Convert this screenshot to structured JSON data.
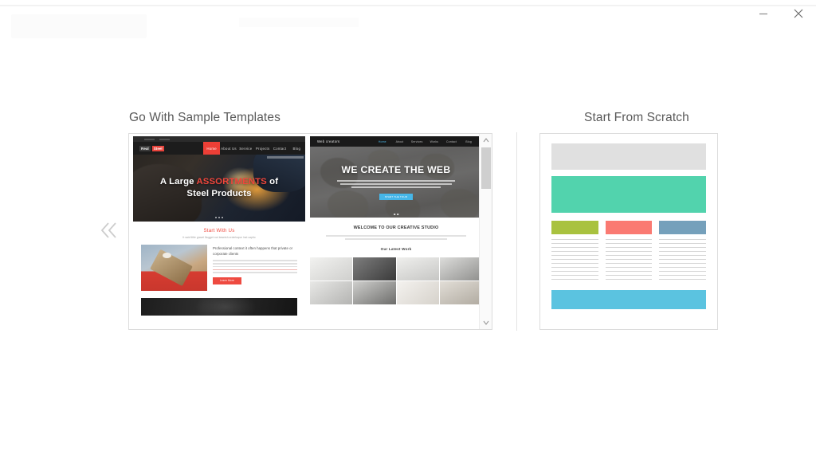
{
  "window": {
    "minimize_label": "Minimize",
    "close_label": "Close",
    "minimize_icon": "minimize-icon",
    "close_icon": "close-icon"
  },
  "nav": {
    "prev_icon": "chevron-double-left-icon",
    "prev_label": "Previous templates"
  },
  "sections": {
    "samples_heading": "Go With Sample Templates",
    "scratch_heading": "Start From Scratch"
  },
  "scrollbar": {
    "up_icon": "chevron-up-icon",
    "down_icon": "chevron-down-icon",
    "thumb_name": "scrollbar-thumb"
  },
  "templates": [
    {
      "id": "real-steel",
      "logo_first": "Real",
      "logo_second": "Steel",
      "menu": [
        "Home",
        "About Us",
        "Service",
        "Projects",
        "Contact",
        "Blog"
      ],
      "active_menu": "Home",
      "hero_line1_a": "A Large ",
      "hero_line1_b": "ASSORTMENTS",
      "hero_line1_c": " of",
      "hero_line2": "Steel Products",
      "section_title": "Start With Us",
      "section_sub": "It said little gravel Nugget not besetch ordertoque Inst captio",
      "feature_heading": "Professional context it often happens that private or corporate clients",
      "button_label": "Learn More"
    },
    {
      "id": "web-creators",
      "logo": "Web creators",
      "menu": [
        "Home",
        "About",
        "Services",
        "Works",
        "Contact",
        "Blog"
      ],
      "active_menu": "Home",
      "hero_title": "WE CREATE THE WEB",
      "hero_button": "START THE TOUR",
      "section_title": "WELCOME TO OUR CREATIVE STUDIO",
      "work_title": "Our Latest Work"
    }
  ],
  "scratch_wireframe": {
    "header_color": "#e0e0e0",
    "hero_color": "#52d3ad",
    "block_colors": [
      "#a9c23f",
      "#fa7a72",
      "#75a0bb"
    ],
    "footer_color": "#5bc3e0",
    "line_color": "#d5d5d5",
    "column_count": 3,
    "lines_per_column": 11
  }
}
